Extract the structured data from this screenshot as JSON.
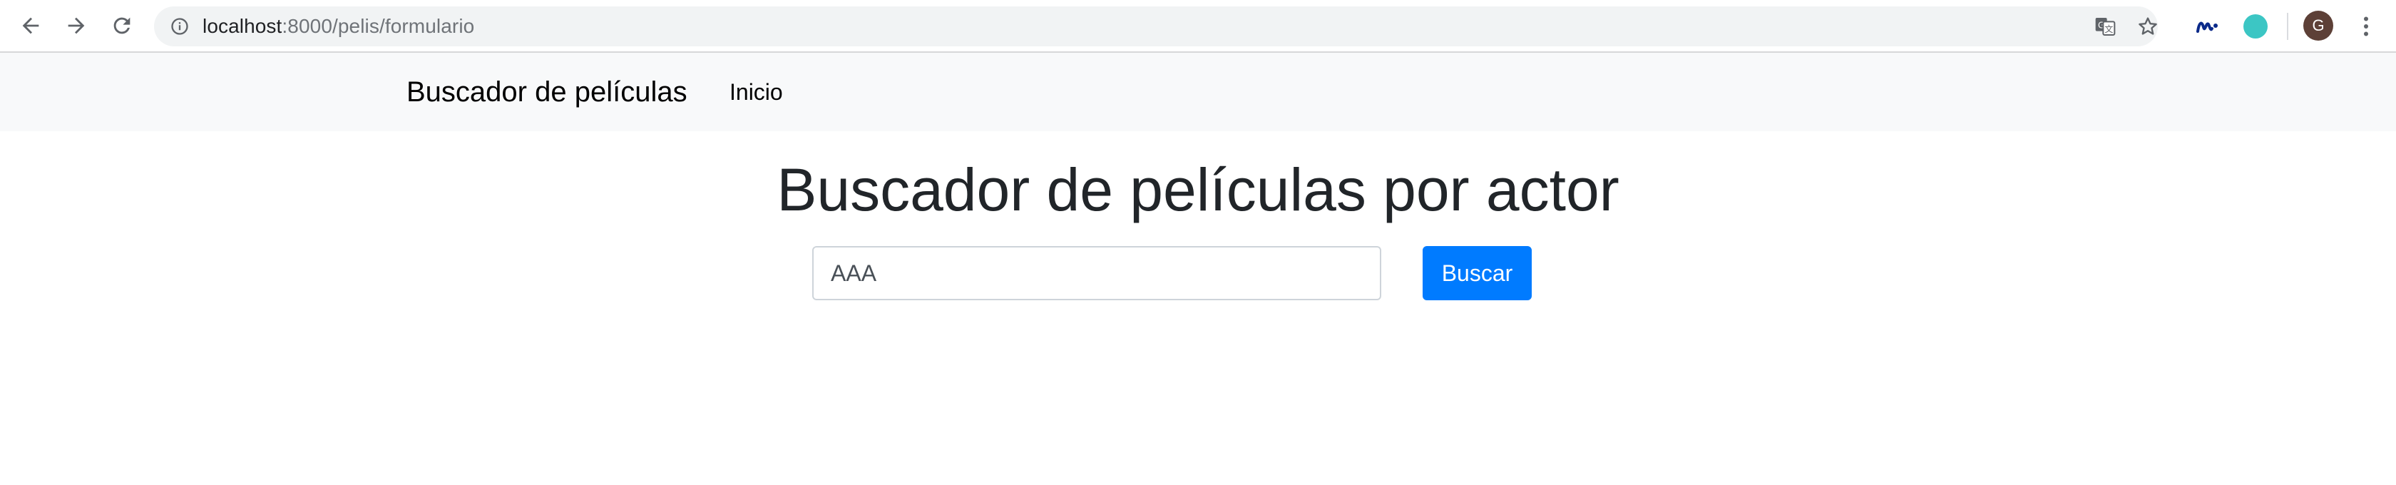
{
  "browser": {
    "url_host": "localhost",
    "url_path": ":8000/pelis/formulario",
    "profile_initial": "G",
    "icons": {
      "back": "back-arrow-icon",
      "forward": "forward-arrow-icon",
      "reload": "reload-icon",
      "site_info": "info-icon",
      "translate": "translate-icon",
      "bookmark": "star-icon",
      "extension_1": "movistar-icon",
      "extension_2": "circle-icon",
      "menu": "kebab-menu-icon"
    },
    "colors": {
      "extension_circle": "#3cc6c4",
      "avatar_bg": "#5d4037"
    }
  },
  "navbar": {
    "brand": "Buscador de películas",
    "links": [
      {
        "label": "Inicio"
      }
    ]
  },
  "main": {
    "title": "Buscador de películas por actor",
    "search": {
      "value": "AAA",
      "button_label": "Buscar"
    }
  },
  "colors": {
    "primary": "#007bff",
    "navbar_bg": "#f8f9fa",
    "text": "#212529"
  }
}
